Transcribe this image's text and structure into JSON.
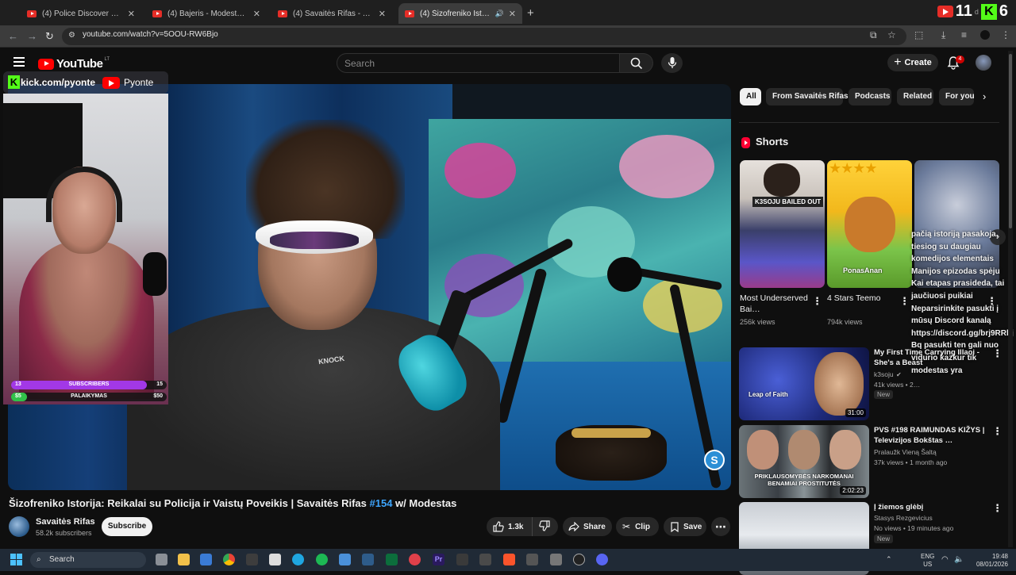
{
  "browser": {
    "tabs": [
      {
        "title": "(4) Police Discover Car Filled W",
        "active": false
      },
      {
        "title": "(4) Bajeris - Modestas - YouTube",
        "active": false
      },
      {
        "title": "(4) Savaitės Rifas - YouTube",
        "active": false
      },
      {
        "title": "(4) Šizofreniko Istorija: Reika",
        "active": true
      }
    ],
    "new_tab": "+",
    "url": "youtube.com/watch?v=5OOU-RW6Bjo",
    "score_overlay": {
      "left": "11",
      "small": "d",
      "right": "6"
    }
  },
  "youtube": {
    "logo_text": "YouTube",
    "country": "LT",
    "search_placeholder": "Search",
    "create_label": "Create",
    "notif_count": "4"
  },
  "video": {
    "overlay": {
      "kick_url": "kick.com/pyonte",
      "yt_name": "Pyonte",
      "bars": [
        {
          "left": "13",
          "label": "SUBSCRIBERS",
          "right": "15",
          "progress": 0.87,
          "color": "#a238e6"
        },
        {
          "left": "$5",
          "label": "PALAIKYMAS",
          "right": "$50",
          "progress": 0.1,
          "color": "#31c24a"
        }
      ]
    },
    "shirt_text": "KNOCK",
    "channel_badge": "S",
    "title_main": "Šizofreniko Istorija: Reikalai su Policija ir Vaistų Poveikis | Savaitės Rifas ",
    "title_hash": "#154",
    "title_tail": " w/ Modestas",
    "channel_name": "Savaitės Rifas",
    "channel_subs": "58.2k subscribers",
    "subscribe_label": "Subscribe",
    "like_count": "1.3k",
    "share_label": "Share",
    "clip_label": "Clip",
    "save_label": "Save"
  },
  "sidebar": {
    "chips": [
      "All",
      "From Savaitės Rifas",
      "Podcasts",
      "Related",
      "For you"
    ],
    "shorts_heading": "Shorts",
    "shorts": [
      {
        "title": "Most Underserved Bai…",
        "views": "256k views",
        "thumb_text": "K3SOJU BAILED OUT"
      },
      {
        "title": "4 Stars Teemo",
        "views": "794k views",
        "thumb_text": "PonasAnan"
      },
      {
        "title": "",
        "views": "",
        "thumb_text": ""
      }
    ],
    "desc_overlay": "pačią istoriją pasakoja, tiesiog su daugiau komedijos elementais Manijos epizodas spėju Kai etapas prasideda, tai jaučiuosi puikiai Neparsirinkite pasukti į mūsų Discord kanalą https://discord.gg/brj9RRbj Bq pasukti ten gali nuo vidurio kazkur tik modestas yra",
    "videos": [
      {
        "title": "My First Time Carrying Illaoi - She's a Beast",
        "channel": "k3soju",
        "meta": "41k views • 2…",
        "badge": "New",
        "duration": "31:00",
        "thumb_text": "Leap of Faith"
      },
      {
        "title": "PVS #198 RAIMUNDAS KIŽYS | Televizijos Bokštas …",
        "channel": "Pralaužk Vieną Šaltą",
        "meta": "37k views • 1 month ago",
        "badge": "",
        "duration": "2:02:23",
        "thumb_text": "PRIKLAUSOMYBĖS NARKOMANAI BENAMIAI PROSTITUTĖS"
      },
      {
        "title": "Į žiemos glėbį",
        "channel": "Stasys Rezgevicius",
        "meta": "No views • 19 minutes ago",
        "badge": "New",
        "duration": "",
        "thumb_text": ""
      }
    ]
  },
  "taskbar": {
    "search_label": "Search",
    "lang_top": "ENG",
    "lang_bottom": "US",
    "time": "19:48",
    "date": "08/01/2026"
  }
}
